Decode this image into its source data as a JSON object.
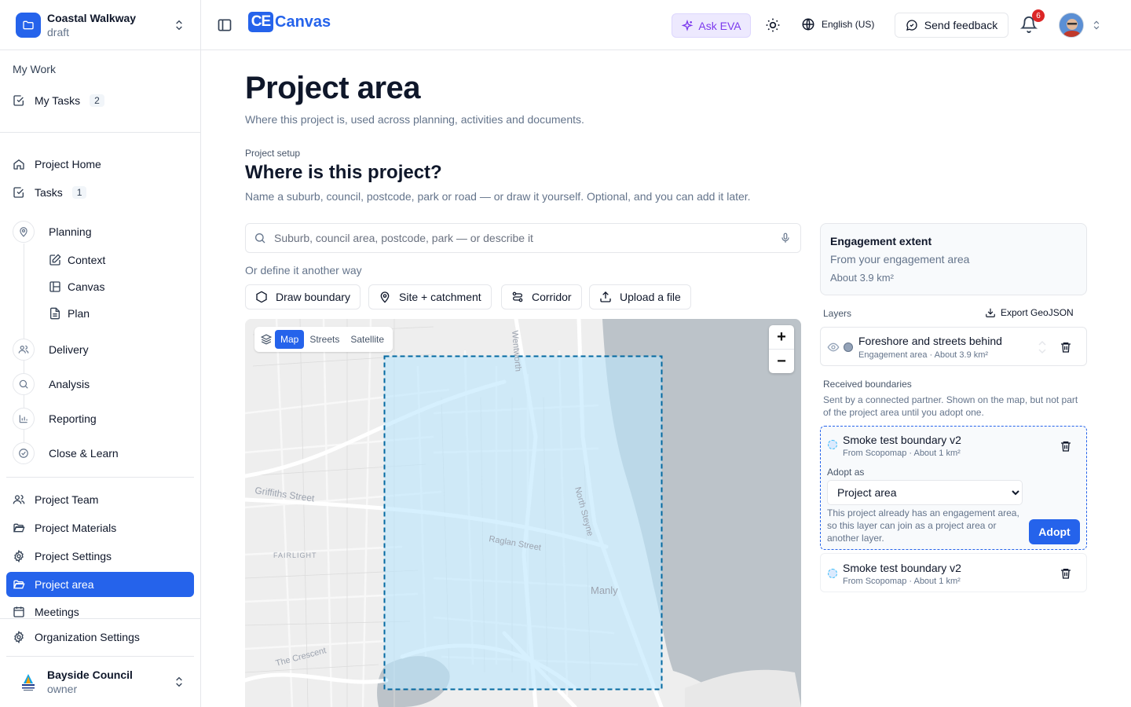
{
  "project": {
    "name": "Coastal Walkway",
    "status": "draft"
  },
  "sidebar": {
    "my_work_label": "My Work",
    "my_tasks": {
      "label": "My Tasks",
      "count": "2"
    },
    "project_home": "Project Home",
    "tasks": {
      "label": "Tasks",
      "count": "1"
    },
    "phases": {
      "planning": "Planning",
      "context": "Context",
      "canvas": "Canvas",
      "plan": "Plan",
      "delivery": "Delivery",
      "analysis": "Analysis",
      "reporting": "Reporting",
      "close_learn": "Close & Learn"
    },
    "project_team": "Project Team",
    "project_materials": "Project Materials",
    "project_settings": "Project Settings",
    "project_area": "Project area",
    "meetings": "Meetings",
    "org_settings": "Organization Settings"
  },
  "org": {
    "name": "Bayside Council",
    "role": "owner"
  },
  "topbar": {
    "logo_mark": "CE",
    "logo_text": "Canvas",
    "ask_eva": "Ask EVA",
    "language": "English (US)",
    "feedback": "Send feedback",
    "notifications": "6"
  },
  "page": {
    "title": "Project area",
    "subtitle": "Where this project is, used across planning, activities and documents.",
    "eyebrow": "Project setup",
    "section_title": "Where is this project?",
    "section_sub": "Name a suburb, council, postcode, park or road — or draw it yourself. Optional, and you can add it later.",
    "search_placeholder": "Suburb, council area, postcode, park — or describe it",
    "or_define": "Or define it another way",
    "tools": {
      "draw": "Draw boundary",
      "site": "Site + catchment",
      "corridor": "Corridor",
      "upload": "Upload a file"
    }
  },
  "map": {
    "toggle": {
      "map": "Map",
      "streets": "Streets",
      "satellite": "Satellite"
    },
    "labels": {
      "griffiths": "Griffiths Street",
      "raglan": "Raglan Street",
      "north_steyne": "North Steyne",
      "fairlight": "FAIRLIGHT",
      "manly": "Manly",
      "crescent": "The Crescent",
      "wentworth": "Wentworth"
    },
    "zoom_in": "+",
    "zoom_out": "−",
    "colors": {
      "boundary_stroke": "#0369a1",
      "boundary_fill": "#bae6fd",
      "water": "#bcc3c9"
    }
  },
  "panel": {
    "extent": {
      "title": "Engagement extent",
      "subtitle": "From your engagement area",
      "area": "About 3.9 km²"
    },
    "layers_label": "Layers",
    "export": "Export GeoJSON",
    "layer1": {
      "name": "Foreshore and streets behind",
      "meta": "Engagement area · About 3.9 km²"
    },
    "received_label": "Received boundaries",
    "received_desc": "Sent by a connected partner. Shown on the map, but not part of the project area until you adopt one.",
    "recv1": {
      "name": "Smoke test boundary v2",
      "meta": "From Scopomap · About 1 km²",
      "adopt_label": "Adopt as",
      "adopt_value": "Project area",
      "note": "This project already has an engagement area, so this layer can join as a project area or another layer.",
      "adopt_button": "Adopt"
    },
    "recv2": {
      "name": "Smoke test boundary v2",
      "meta": "From Scopomap · About 1 km²"
    }
  }
}
